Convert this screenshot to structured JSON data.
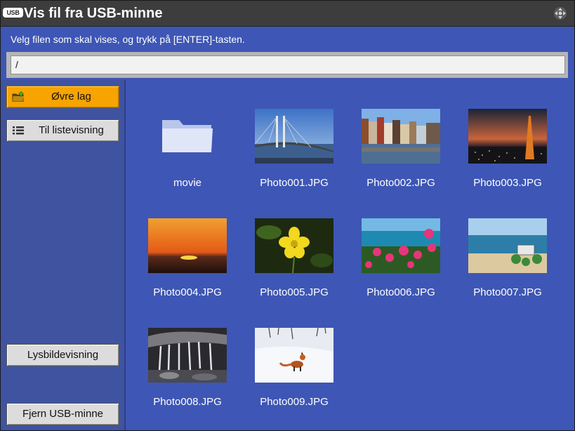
{
  "window": {
    "usb_icon_text": "USB",
    "title": "Vis fil fra USB-minne",
    "nav_icon": "dpad-navigation-icon"
  },
  "instruction": "Velg filen som skal vises, og trykk på [ENTER]-tasten.",
  "path": "/",
  "sidebar": {
    "upper_level": {
      "label": "Øvre lag",
      "icon": "folder-up-icon",
      "accent": "#f7a400"
    },
    "list_view": {
      "label": "Til listevisning",
      "icon": "list-icon"
    },
    "slideshow": {
      "label": "Lysbildevisning"
    },
    "remove_usb": {
      "label": "Fjern USB-minne"
    }
  },
  "files": [
    {
      "name": "movie",
      "type": "folder"
    },
    {
      "name": "Photo001.JPG",
      "type": "image",
      "scene": "bridge"
    },
    {
      "name": "Photo002.JPG",
      "type": "image",
      "scene": "canal-houses"
    },
    {
      "name": "Photo003.JPG",
      "type": "image",
      "scene": "tower-night"
    },
    {
      "name": "Photo004.JPG",
      "type": "image",
      "scene": "sunset"
    },
    {
      "name": "Photo005.JPG",
      "type": "image",
      "scene": "yellow-flower"
    },
    {
      "name": "Photo006.JPG",
      "type": "image",
      "scene": "flowers-sea"
    },
    {
      "name": "Photo007.JPG",
      "type": "image",
      "scene": "beach-rover"
    },
    {
      "name": "Photo008.JPG",
      "type": "image",
      "scene": "waterfall"
    },
    {
      "name": "Photo009.JPG",
      "type": "image",
      "scene": "fox-snow"
    }
  ],
  "colors": {
    "background": "#3e56b5",
    "sidebar": "#3f53a0",
    "titlebar": "#3d3d3d",
    "selected_button": "#f7a400"
  }
}
